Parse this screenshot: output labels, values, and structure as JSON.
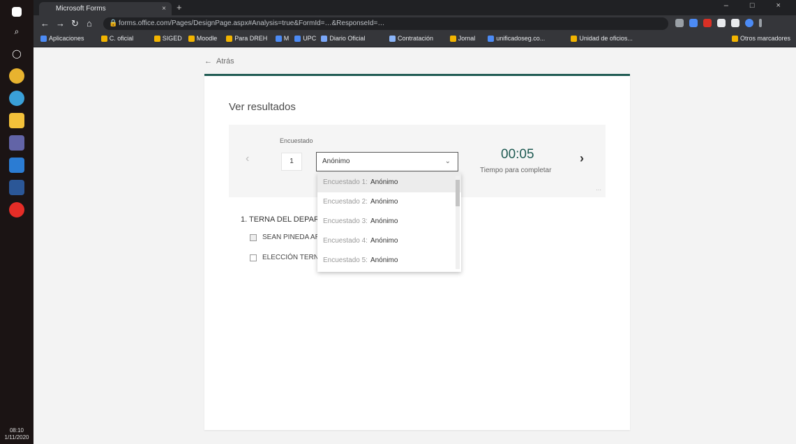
{
  "browser": {
    "tab_title": "Microsoft Forms",
    "tab_close": "×",
    "new_tab": "+",
    "url": "forms.office.com/Pages/DesignPage.aspx#Analysis=true&FormId=…&ResponseId=…",
    "bookmarks": [
      {
        "label": "Aplicaciones",
        "color": "#4c8bf5"
      },
      {
        "label": "C. oficial",
        "color": "#f2b400"
      },
      {
        "label": "SIGED",
        "color": "#f2b400"
      },
      {
        "label": "Moodle",
        "color": "#f2b400"
      },
      {
        "label": "Para DREH",
        "color": "#f2b400"
      },
      {
        "label": "M",
        "color": "#4c8bf5"
      },
      {
        "label": "UPC",
        "color": "#4c8bf5"
      },
      {
        "label": "Diario Oficial",
        "color": "#7aa7f9"
      },
      {
        "label": "Contratación",
        "color": "#8ab4f8"
      },
      {
        "label": "Jornal",
        "color": "#f2b400"
      },
      {
        "label": "unificadoseg.co...",
        "color": "#4c8bf5"
      },
      {
        "label": "Unidad de oficios...",
        "color": "#f2b400"
      },
      {
        "label": "Otros marcadores",
        "color": "#f2b400"
      }
    ]
  },
  "taskbar": {
    "clock_time": "08:10",
    "clock_date": "1/11/2020",
    "icons": [
      {
        "name": "windows-icon",
        "color": "#ffffff"
      },
      {
        "name": "search-icon",
        "color": "#ffffff"
      },
      {
        "name": "cortana-icon",
        "color": "#ffffff"
      },
      {
        "name": "chrome-icon",
        "color": "#e8b32f"
      },
      {
        "name": "edge-icon",
        "color": "#3aa0d8"
      },
      {
        "name": "file-explorer-icon",
        "color": "#f3c13a"
      },
      {
        "name": "teams-icon",
        "color": "#6264a7"
      },
      {
        "name": "outlook-icon",
        "color": "#2b7cd3"
      },
      {
        "name": "word-icon",
        "color": "#2b5797"
      },
      {
        "name": "youtube-icon",
        "color": "#e52d27"
      }
    ]
  },
  "page": {
    "back_label": "Atrás",
    "card_title": "Ver resultados",
    "accent_color": "#1e5a52",
    "respondent_label": "Encuestado",
    "respondent_number": "1",
    "respondent_selected": "Anónimo",
    "time_value": "00:05",
    "time_label": "Tiempo para completar",
    "panel_foot": "···",
    "question_title": "1. TERNA DEL DEPAR",
    "options": [
      {
        "label": "SEAN PINEDA AR",
        "checked": true
      },
      {
        "label": "ELECCIÓN TERNA",
        "checked": false
      }
    ]
  },
  "dropdown": {
    "items": [
      {
        "prefix": "Encuestado 1:",
        "name": "Anónimo",
        "selected": true
      },
      {
        "prefix": "Encuestado 2:",
        "name": "Anónimo",
        "selected": false
      },
      {
        "prefix": "Encuestado 3:",
        "name": "Anónimo",
        "selected": false
      },
      {
        "prefix": "Encuestado 4:",
        "name": "Anónimo",
        "selected": false
      },
      {
        "prefix": "Encuestado 5:",
        "name": "Anónimo",
        "selected": false
      }
    ]
  }
}
